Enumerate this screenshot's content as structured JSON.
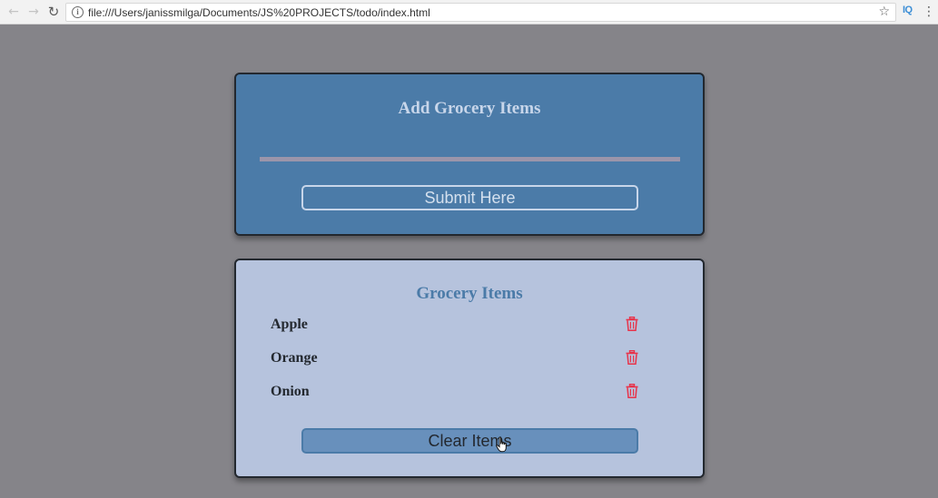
{
  "browser": {
    "url": "file:///Users/janissmilga/Documents/JS%20PROJECTS/todo/index.html",
    "icons": {
      "back": "arrow-left-icon",
      "forward": "arrow-right-icon",
      "reload": "reload-icon",
      "info": "info-icon",
      "bookmark": "star-icon",
      "menu": "kebab-menu-icon"
    },
    "extension_label": "IQ"
  },
  "add_form": {
    "title": "Add Grocery Items",
    "input_value": "",
    "submit_label": "Submit Here"
  },
  "grocery_list": {
    "title": "Grocery Items",
    "items": [
      {
        "name": "Apple"
      },
      {
        "name": "Orange"
      },
      {
        "name": "Onion"
      }
    ],
    "delete_icon": "trash-icon",
    "clear_label": "Clear Items"
  },
  "colors": {
    "page_background": "#858489",
    "card_primary": "#4b7ba8",
    "card_secondary": "#b6c3dd",
    "text_dark": "#23282f",
    "delete_icon": "#e8334a"
  }
}
